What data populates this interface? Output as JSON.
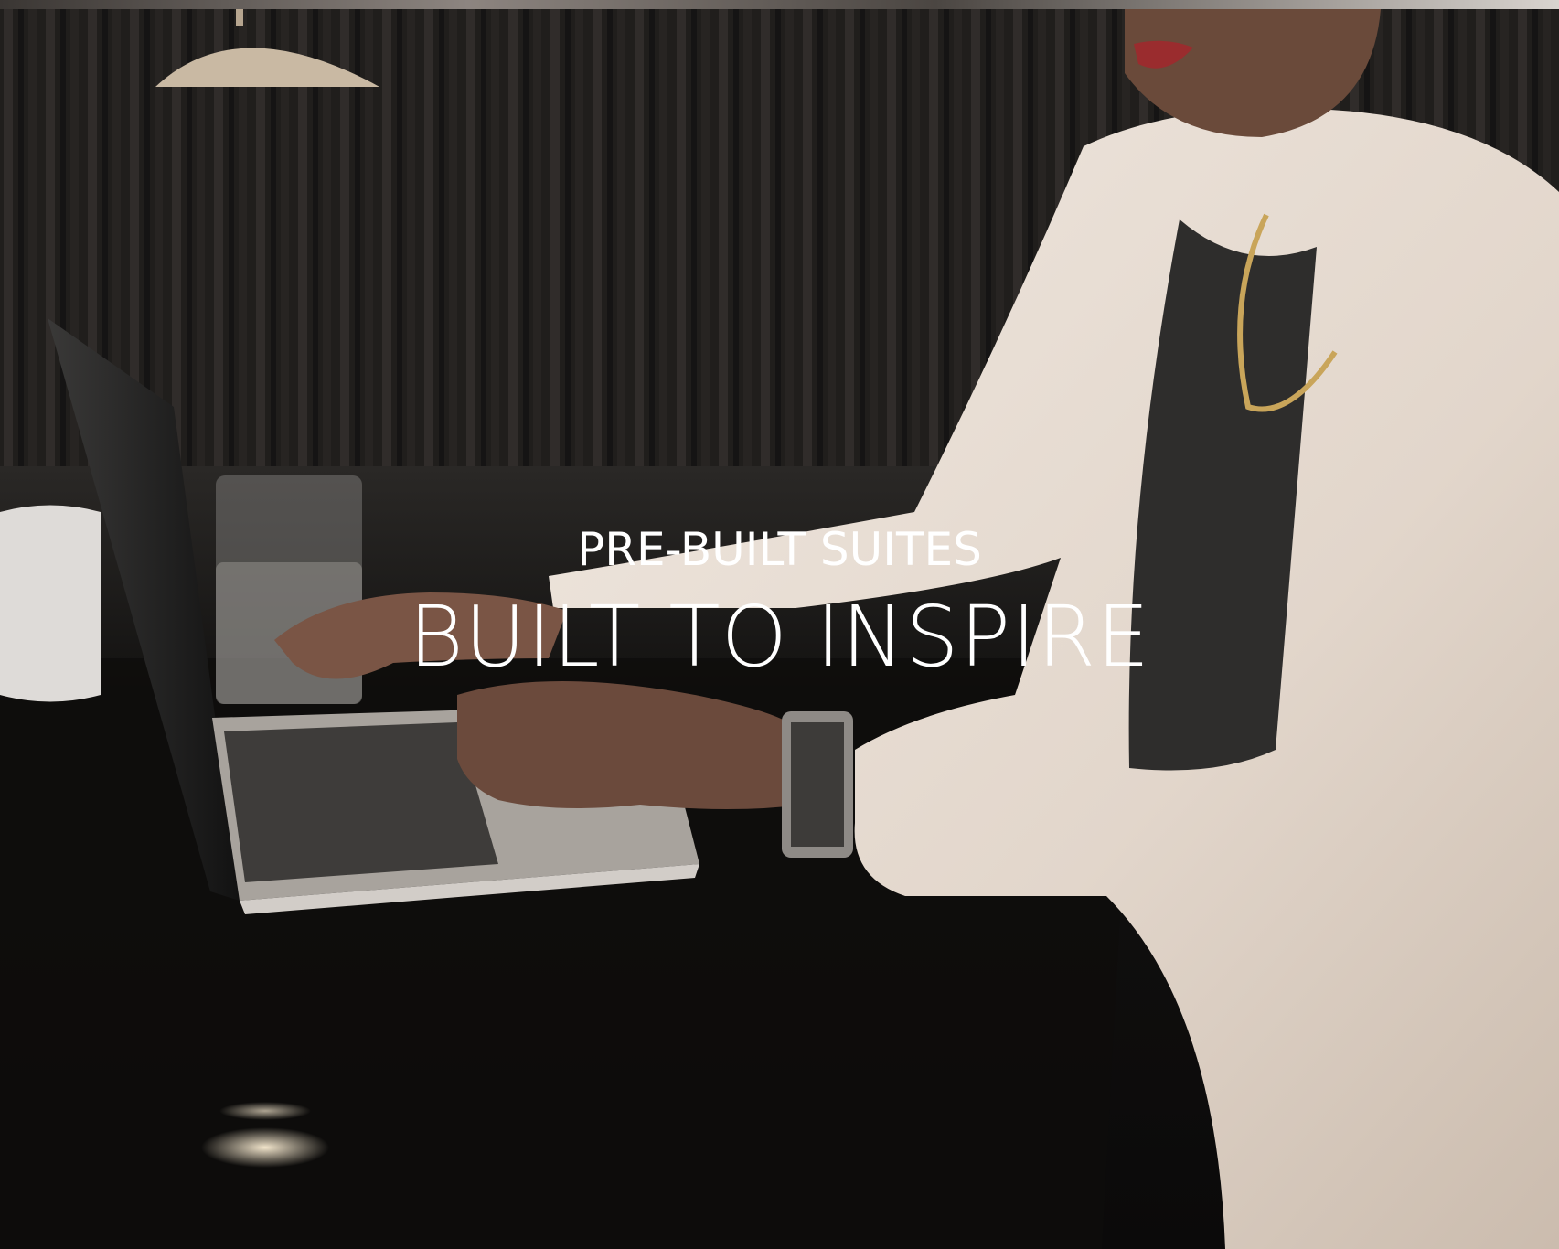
{
  "hero": {
    "eyebrow": "PRE-BUILT SUITES",
    "headline": "BUILT TO INSPIRE",
    "image": "woman-typing-on-laptop-photo"
  },
  "colors": {
    "text": "#ffffff",
    "blazer": "#e6dcd2",
    "desk": "#141312",
    "curtain": "#2f2c2a"
  }
}
